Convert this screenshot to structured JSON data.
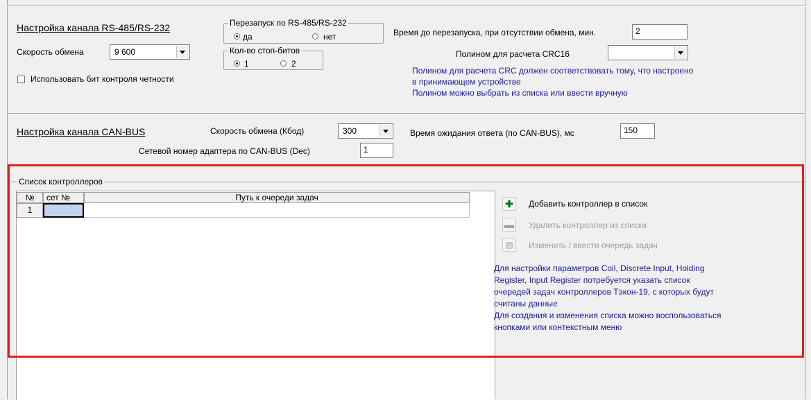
{
  "rs485": {
    "title": "Настройка канала RS-485/RS-232",
    "speed_label": "Скорость обмена",
    "speed_value": "9 600",
    "parity_label": "Использовать бит контроля четности",
    "restart_group": "Перезапуск по RS-485/RS-232",
    "restart_yes": "да",
    "restart_no": "нет",
    "stopbits_group": "Кол-во стоп-битов",
    "stopbits_1": "1",
    "stopbits_2": "2",
    "restart_time_label": "Время до перезапуска, при отсутствии обмена, мин.",
    "restart_time_value": "2",
    "crc_label": "Полином для расчета CRC16",
    "crc_value": "",
    "note1": "Полином для расчета CRC должен соответствовать тому, что настроено",
    "note2": "в принимающем устройстве",
    "note3": "Полином можно выбрать из списка или ввести вручную"
  },
  "can": {
    "title": "Настройка  канала CAN-BUS",
    "speed_label": "Скорость обмена (Кбод)",
    "speed_value": "300",
    "timeout_label": "Время ожидания ответа (по CAN-BUS), мс",
    "timeout_value": "150",
    "netnum_label": "Сетевой номер адаптера по  CAN-BUS  (Dec)",
    "netnum_value": "1"
  },
  "controllers": {
    "group_title": "Список контроллеров",
    "columns": [
      "№",
      "сет №",
      "Путь к очереди задач"
    ],
    "rows": [
      [
        "1",
        "",
        ""
      ]
    ],
    "add_label": "Добавить контроллер в список",
    "delete_label": "Удалить контроллер из списка",
    "edit_label": "Изменить / ввести очередь задач",
    "info": [
      "Для настройки параметров Coil, Discrete Input, Holding",
      "Register, Input Register потребуется указать список",
      "очередей задач контроллеров Тэкон-19, с которых будут",
      "считаны данные",
      "Для создания и изменения списка можно воспользоваться",
      "кнопками или контекстным меню"
    ]
  },
  "icons": {
    "add": "plus-icon",
    "delete": "minus-icon",
    "edit": "document-arrow-icon"
  },
  "colors": {
    "accent_blue": "#1a1aa0",
    "highlight_red": "#e0201e",
    "selected_cell": "#c4d4f0"
  }
}
